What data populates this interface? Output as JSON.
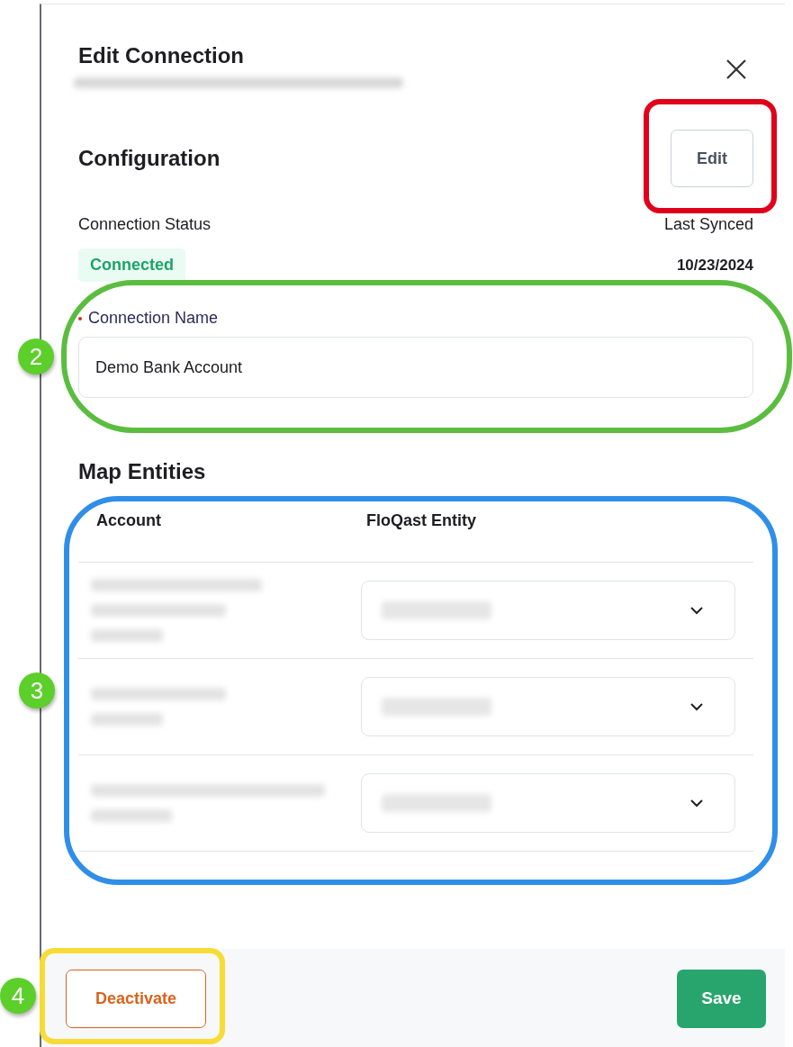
{
  "header": {
    "title": "Edit Connection",
    "subtitle": {
      "kind": "redacted"
    }
  },
  "configuration": {
    "title": "Configuration",
    "edit_button": {
      "label": "Edit",
      "highlight": {
        "color": "#e0001b"
      }
    },
    "status_label": "Connection Status",
    "status": "Connected",
    "last_synced_label": "Last Synced",
    "last_synced": "10/23/2024"
  },
  "connection_name": {
    "label": "Connection Name",
    "required": true,
    "value": "Demo Bank Account",
    "highlight": {
      "color": "#5bbd3f",
      "callout": "2"
    }
  },
  "map_entities": {
    "title": "Map Entities",
    "columns": [
      "Account",
      "FloQast Entity"
    ],
    "highlight": {
      "color": "#2f8fe8",
      "callout": "3"
    },
    "rows": [
      {
        "kind": "redacted"
      },
      {
        "kind": "redacted"
      },
      {
        "kind": "redacted"
      }
    ]
  },
  "footer": {
    "deactivate": {
      "label": "Deactivate",
      "highlight": {
        "color": "#f7dc37",
        "callout": "4"
      }
    },
    "save": "Save"
  }
}
